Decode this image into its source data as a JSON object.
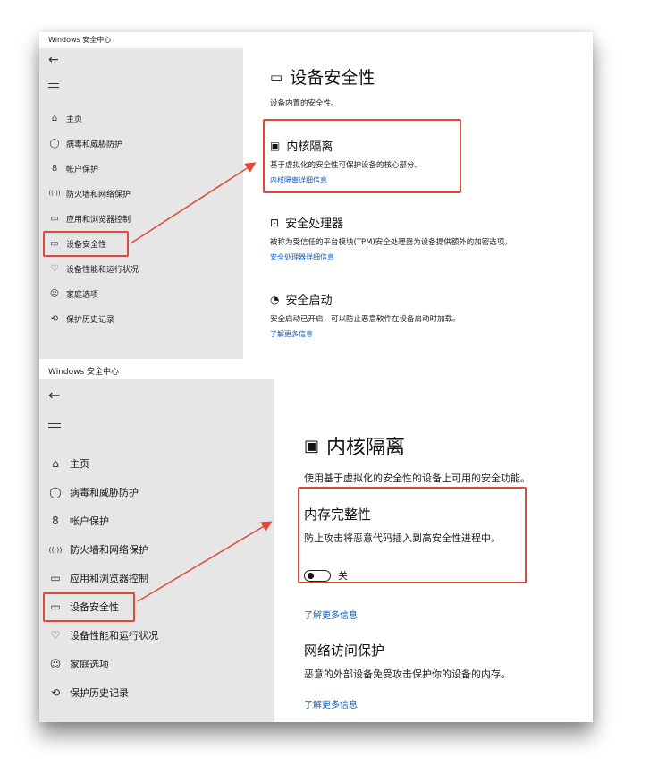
{
  "panel_top": {
    "window_title": "Windows 安全中心",
    "back_icon": "←",
    "nav": [
      {
        "icon": "⌂",
        "label": "主页"
      },
      {
        "icon": "◯",
        "label": "病毒和威胁防护"
      },
      {
        "icon": "8",
        "label": "帐户保护"
      },
      {
        "icon": "((·))",
        "label": "防火墙和网络保护"
      },
      {
        "icon": "▭",
        "label": "应用和浏览器控制"
      },
      {
        "icon": "▭",
        "label": "设备安全性"
      },
      {
        "icon": "♡",
        "label": "设备性能和运行状况"
      },
      {
        "icon": "☺",
        "label": "家庭选项"
      },
      {
        "icon": "⟲",
        "label": "保护历史记录"
      }
    ],
    "page_title": "设备安全性",
    "page_subtitle": "设备内置的安全性。",
    "sections": [
      {
        "title": "内核隔离",
        "desc": "基于虚拟化的安全性可保护设备的核心部分。",
        "link": "内核隔离详细信息"
      },
      {
        "title": "安全处理器",
        "desc": "被称为受信任的平台模块(TPM)安全处理器为设备提供额外的加密选项。",
        "link": "安全处理器详细信息"
      },
      {
        "title": "安全启动",
        "desc": "安全启动已开启，可以防止恶意软件在设备启动时加载。",
        "link": "了解更多信息"
      }
    ]
  },
  "panel_bottom": {
    "window_title": "Windows 安全中心",
    "back_icon": "←",
    "nav": [
      {
        "icon": "⌂",
        "label": "主页"
      },
      {
        "icon": "◯",
        "label": "病毒和威胁防护"
      },
      {
        "icon": "8",
        "label": "帐户保护"
      },
      {
        "icon": "((·))",
        "label": "防火墙和网络保护"
      },
      {
        "icon": "▭",
        "label": "应用和浏览器控制"
      },
      {
        "icon": "▭",
        "label": "设备安全性"
      },
      {
        "icon": "♡",
        "label": "设备性能和运行状况"
      },
      {
        "icon": "☺",
        "label": "家庭选项"
      },
      {
        "icon": "⟲",
        "label": "保护历史记录"
      }
    ],
    "page_title": "内核隔离",
    "page_subtitle": "使用基于虚拟化的安全性的设备上可用的安全功能。",
    "memory_integrity": {
      "title": "内存完整性",
      "desc": "防止攻击将恶意代码插入到高安全性进程中。",
      "toggle_state": "关",
      "toggle_on": false
    },
    "link1": "了解更多信息",
    "network": {
      "title": "网络访问保护",
      "desc": "恶意的外部设备免受攻击保护你的设备的内存。",
      "link": "了解更多信息"
    }
  },
  "colors": {
    "highlight_box": "#e0483a",
    "link": "#1060c0",
    "sidebar_bg": "#e6e6e6"
  }
}
